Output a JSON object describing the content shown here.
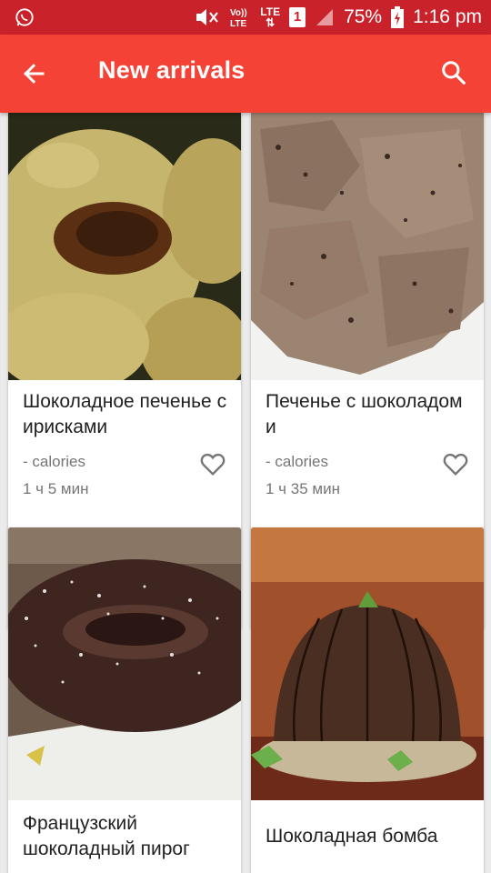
{
  "status_bar": {
    "battery": "75%",
    "time": "1:16 pm",
    "network": "LTE",
    "sim": "1"
  },
  "app_bar": {
    "title": "New arrivals"
  },
  "recipes": [
    {
      "name": "Шоколадное печенье с ирисками",
      "calories": "- calories",
      "time": "1 ч 5 мин"
    },
    {
      "name": "Печенье с шоколадом и",
      "calories": "- calories",
      "time": "1 ч 35 мин"
    },
    {
      "name": "Французский шоколадный пирог"
    },
    {
      "name": "Шоколадная бомба"
    }
  ],
  "colors": {
    "status_bar": "#c9222a",
    "app_bar": "#f44336",
    "background": "#ebebeb"
  }
}
